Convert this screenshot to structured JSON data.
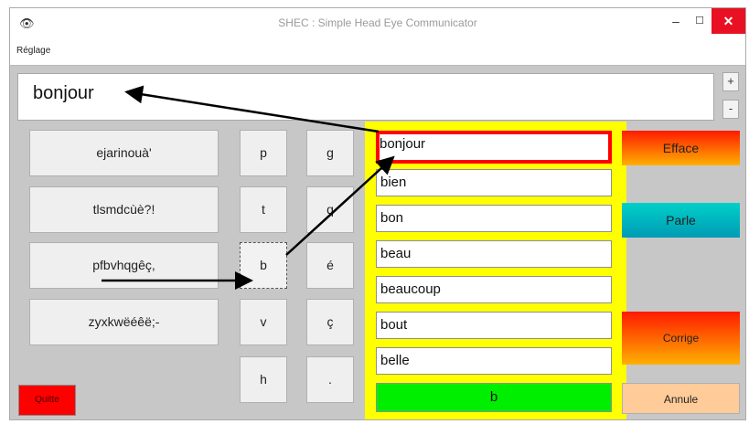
{
  "window": {
    "title": "SHEC : Simple Head Eye Communicator",
    "minimize": "–",
    "maximize": "☐",
    "close": "✕",
    "app_icon": "eye-icon"
  },
  "menu": {
    "items": [
      "Réglage"
    ]
  },
  "message": {
    "text": "bonjour"
  },
  "size_buttons": {
    "plus": "+",
    "minus": "-"
  },
  "letter_groups": [
    "ejarinouà'",
    "tlsmdcùè?!",
    "pfbvhqgêç,",
    "zyxkwëéêë;-"
  ],
  "letter_keys": [
    [
      "p",
      "g"
    ],
    [
      "t",
      "q"
    ],
    [
      "b",
      "é"
    ],
    [
      "v",
      "ç"
    ],
    [
      "h",
      "."
    ]
  ],
  "selected_key": "b",
  "suggestions": [
    "bonjour",
    "bien",
    "bon",
    "beau",
    "beaucoup",
    "bout",
    "belle"
  ],
  "highlighted_suggestion": "bonjour",
  "current_letters": "b",
  "actions": {
    "effacer": "Efface",
    "parle": "Parle",
    "corrige": "Corrige",
    "annule": "Annule",
    "quitter": "Quitte"
  },
  "colors": {
    "close_button": "#e81123",
    "word_panel": "#ffff00",
    "highlight_border": "#ff0000",
    "current_letters": "#00ee00",
    "quitter": "#ff0000",
    "annule": "#ffcc99"
  }
}
